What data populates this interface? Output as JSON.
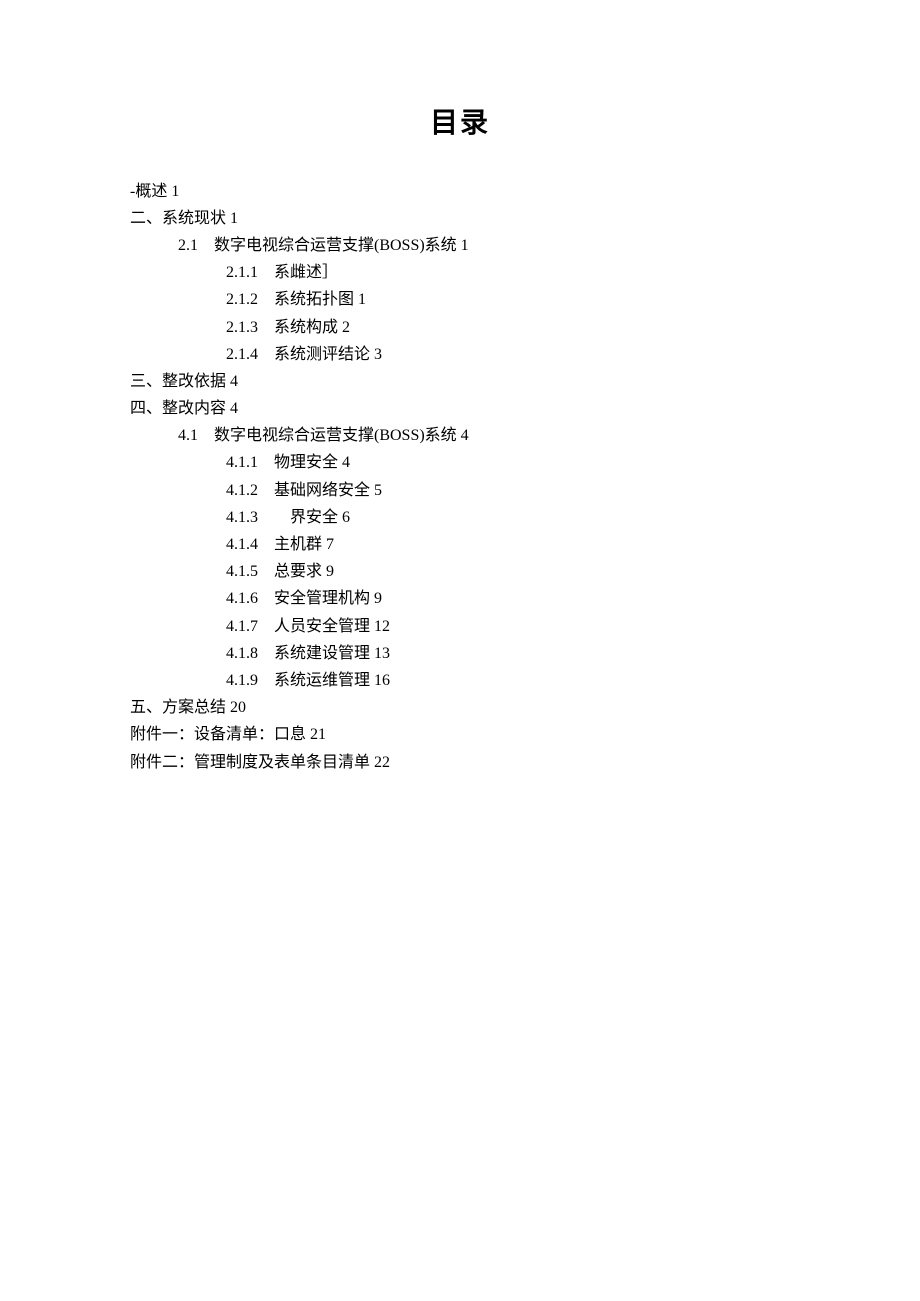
{
  "title": "目录",
  "lines": [
    {
      "level": 0,
      "text": "-概述 1"
    },
    {
      "level": 0,
      "text": "二、系统现状 1"
    },
    {
      "level": 1,
      "text": "2.1　数字电视综合运营支撑(BOSS)系统 1"
    },
    {
      "level": 2,
      "text": "2.1.1　系雌述］"
    },
    {
      "level": 2,
      "text": "2.1.2　系统拓扑图 1"
    },
    {
      "level": 2,
      "text": "2.1.3　系统构成 2"
    },
    {
      "level": 2,
      "text": "2.1.4　系统测评结论 3"
    },
    {
      "level": 0,
      "text": "三、整改依据 4"
    },
    {
      "level": 0,
      "text": "四、整改内容 4"
    },
    {
      "level": 1,
      "text": "4.1　数字电视综合运营支撑(BOSS)系统 4"
    },
    {
      "level": 2,
      "text": "4.1.1　物理安全 4"
    },
    {
      "level": 2,
      "text": "4.1.2　基础网络安全 5"
    },
    {
      "level": 2,
      "text": "4.1.3　　界安全 6"
    },
    {
      "level": 2,
      "text": "4.1.4　主机群 7"
    },
    {
      "level": 2,
      "text": "4.1.5　总要求 9"
    },
    {
      "level": 2,
      "text": "4.1.6　安全管理机构 9"
    },
    {
      "level": 2,
      "text": "4.1.7　人员安全管理 12"
    },
    {
      "level": 2,
      "text": "4.1.8　系统建设管理 13"
    },
    {
      "level": 2,
      "text": "4.1.9　系统运维管理 16"
    },
    {
      "level": 0,
      "text": "五、方案总结 20"
    },
    {
      "level": 0,
      "text": "附件一：设备清单：口息 21"
    },
    {
      "level": 0,
      "text": "附件二：管理制度及表单条目清单 22"
    }
  ]
}
